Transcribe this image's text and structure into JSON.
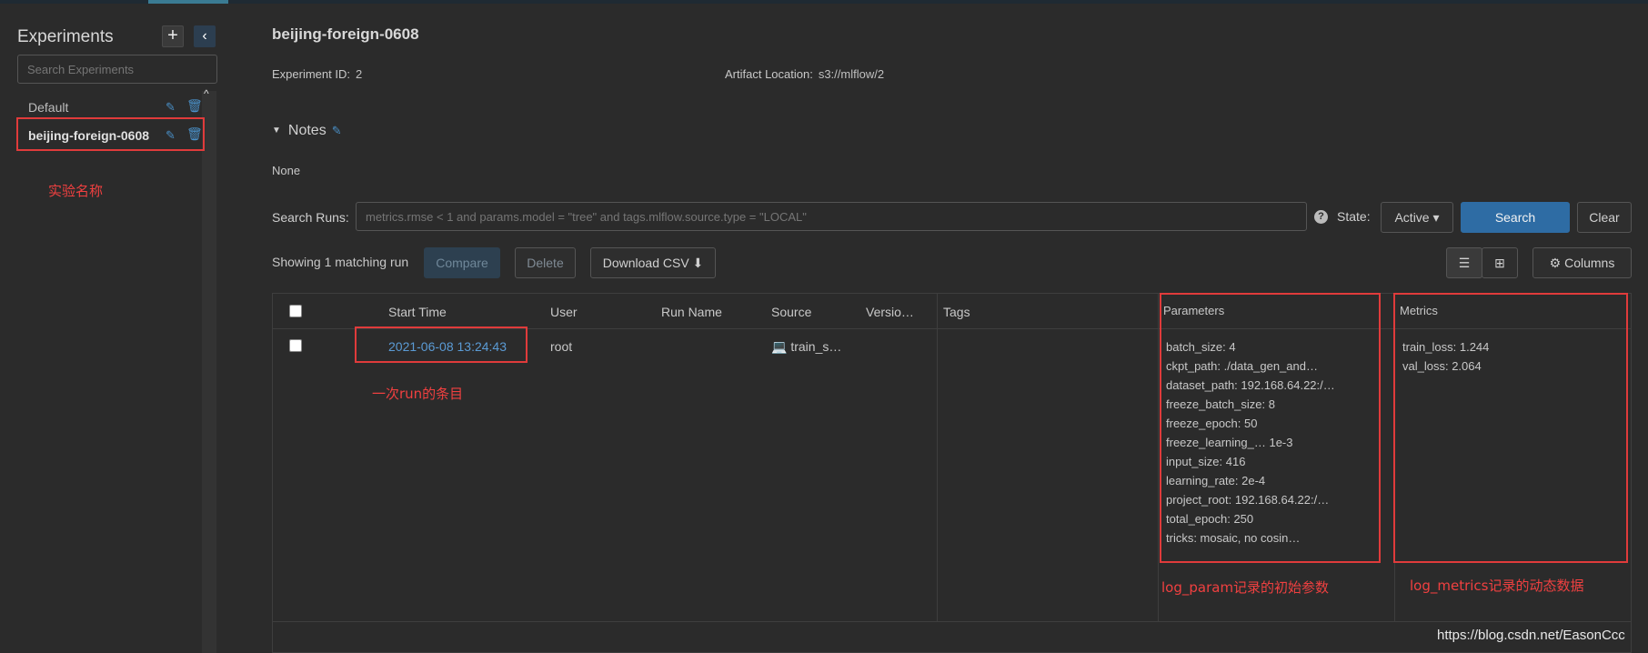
{
  "sidebar": {
    "title": "Experiments",
    "add_icon": "+",
    "collapse_icon": "‹",
    "search_placeholder": "Search Experiments",
    "experiments": [
      {
        "name": "Default"
      },
      {
        "name": "beijing-foreign-0608"
      }
    ],
    "annotation": "实验名称"
  },
  "experiment": {
    "title": "beijing-foreign-0608",
    "id_label": "Experiment ID:",
    "id_value": "2",
    "artifact_label": "Artifact Location:",
    "artifact_value": "s3://mlflow/2",
    "notes_label": "Notes",
    "notes_body": "None"
  },
  "search": {
    "label": "Search Runs:",
    "placeholder": "metrics.rmse < 1 and params.model = \"tree\" and tags.mlflow.source.type = \"LOCAL\"",
    "help_icon": "?",
    "state_label": "State:",
    "state_value": "Active ▾",
    "search_button": "Search",
    "clear_button": "Clear"
  },
  "toolbar": {
    "showing": "Showing 1 matching run",
    "compare": "Compare",
    "delete": "Delete",
    "download": "Download CSV",
    "columns": "Columns"
  },
  "table": {
    "headers": {
      "start_time": "Start Time",
      "user": "User",
      "run_name": "Run Name",
      "source": "Source",
      "version": "Versio…",
      "tags": "Tags",
      "parameters": "Parameters",
      "metrics": "Metrics"
    },
    "run": {
      "start_time": "2021-06-08 13:24:43",
      "user": "root",
      "run_name": "",
      "source": "train_s…",
      "parameters": [
        "batch_size: 4",
        "ckpt_path: ./data_gen_and…",
        "dataset_path: 192.168.64.22:/…",
        "freeze_batch_size: 8",
        "freeze_epoch: 50",
        "freeze_learning_… 1e-3",
        "input_size: 416",
        "learning_rate: 2e-4",
        "project_root: 192.168.64.22:/…",
        "total_epoch: 250",
        "tricks: mosaic, no cosin…"
      ],
      "metrics": [
        "train_loss: 1.244",
        "val_loss: 2.064"
      ]
    },
    "annotations": {
      "run": "一次run的条目",
      "params": "log_param记录的初始参数",
      "metrics": "log_metrics记录的动态数据"
    }
  },
  "watermark": "https://blog.csdn.net/EasonCcc"
}
